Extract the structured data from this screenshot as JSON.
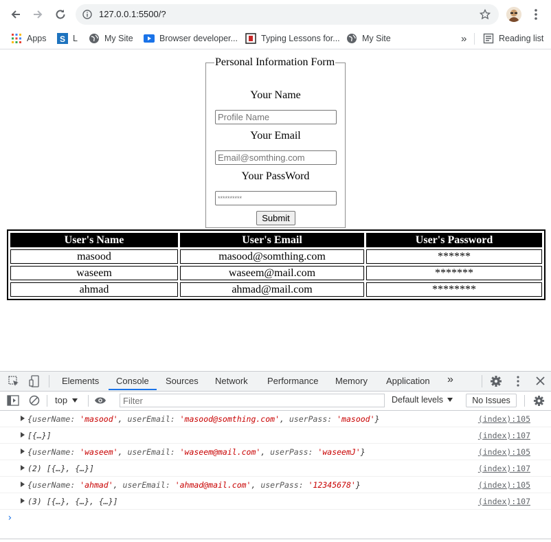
{
  "browser": {
    "url": "127.0.0.1:5500/?",
    "bookmarks": [
      {
        "label": "Apps",
        "icon": "apps-grid-icon"
      },
      {
        "label": "L",
        "icon": "s-logo-icon"
      },
      {
        "label": "My Site",
        "icon": "globe-icon"
      },
      {
        "label": "Browser developer...",
        "icon": "video-icon"
      },
      {
        "label": "Typing Lessons for...",
        "icon": "typing-icon"
      },
      {
        "label": "My Site",
        "icon": "globe-icon"
      }
    ],
    "more_bookmarks": "»",
    "reading_list": "Reading list"
  },
  "form": {
    "legend": "Personal Information Form",
    "name_label": "Your Name",
    "name_placeholder": "Profile Name",
    "email_label": "Your Email",
    "email_placeholder": "Email@somthing.com",
    "password_label": "Your PassWord",
    "password_placeholder": "**********",
    "submit_label": "Submit"
  },
  "table": {
    "headers": [
      "User's Name",
      "User's Email",
      "User's Password"
    ],
    "rows": [
      [
        "masood",
        "masood@somthing.com",
        "******"
      ],
      [
        "waseem",
        "waseem@mail.com",
        "*******"
      ],
      [
        "ahmad",
        "ahmad@mail.com",
        "********"
      ]
    ]
  },
  "devtools": {
    "tabs": [
      "Elements",
      "Console",
      "Sources",
      "Network",
      "Performance",
      "Memory",
      "Application"
    ],
    "active_tab": "Console",
    "more_tabs": "»",
    "context": "top",
    "filter_placeholder": "Filter",
    "levels": "Default levels",
    "issues": "No Issues",
    "accent_color": "#1a73e8",
    "console_lines": [
      {
        "type": "object",
        "userName": "'masood'",
        "userEmail": "'masood@somthing.com'",
        "userPass": "'masood'",
        "source": "(index):105"
      },
      {
        "type": "array",
        "text": "[{…}]",
        "source": "(index):107"
      },
      {
        "type": "object",
        "userName": "'waseem'",
        "userEmail": "'waseem@mail.com'",
        "userPass": "'waseemJ'",
        "source": "(index):105"
      },
      {
        "type": "array",
        "text": "(2) [{…}, {…}]",
        "source": "(index):107"
      },
      {
        "type": "object",
        "userName": "'ahmad'",
        "userEmail": "'ahmad@mail.com'",
        "userPass": "'12345678'",
        "source": "(index):105"
      },
      {
        "type": "array",
        "text": "(3) [{…}, {…}, {…}]",
        "source": "(index):107"
      }
    ],
    "prompt": "›"
  }
}
